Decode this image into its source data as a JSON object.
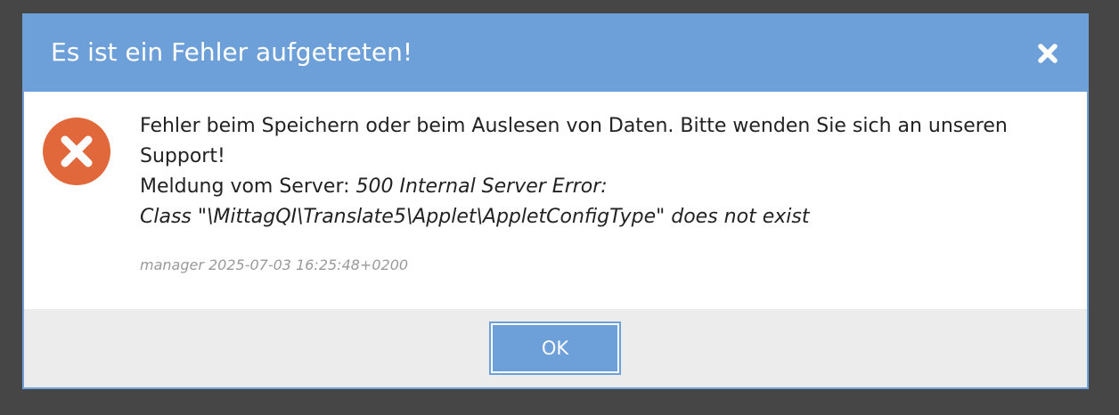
{
  "dialog": {
    "title": "Es ist ein Fehler aufgetreten!",
    "close_icon": "close-icon",
    "error_icon": "error-x-circle-icon",
    "message": {
      "line1": "Fehler beim Speichern oder beim Auslesen von Daten. Bitte wenden Sie sich an unseren Support!",
      "server_prefix": "Meldung vom Server: ",
      "server_error": "500 Internal Server Error:",
      "server_detail": "Class \"\\MittagQI\\Translate5\\Applet\\AppletConfigType\" does not exist"
    },
    "meta": "manager 2025-07-03 16:25:48+0200",
    "ok_label": "OK"
  },
  "colors": {
    "header": "#6d9fd8",
    "error_icon": "#e0683a",
    "footer": "#ececec",
    "backdrop": "#464646"
  }
}
